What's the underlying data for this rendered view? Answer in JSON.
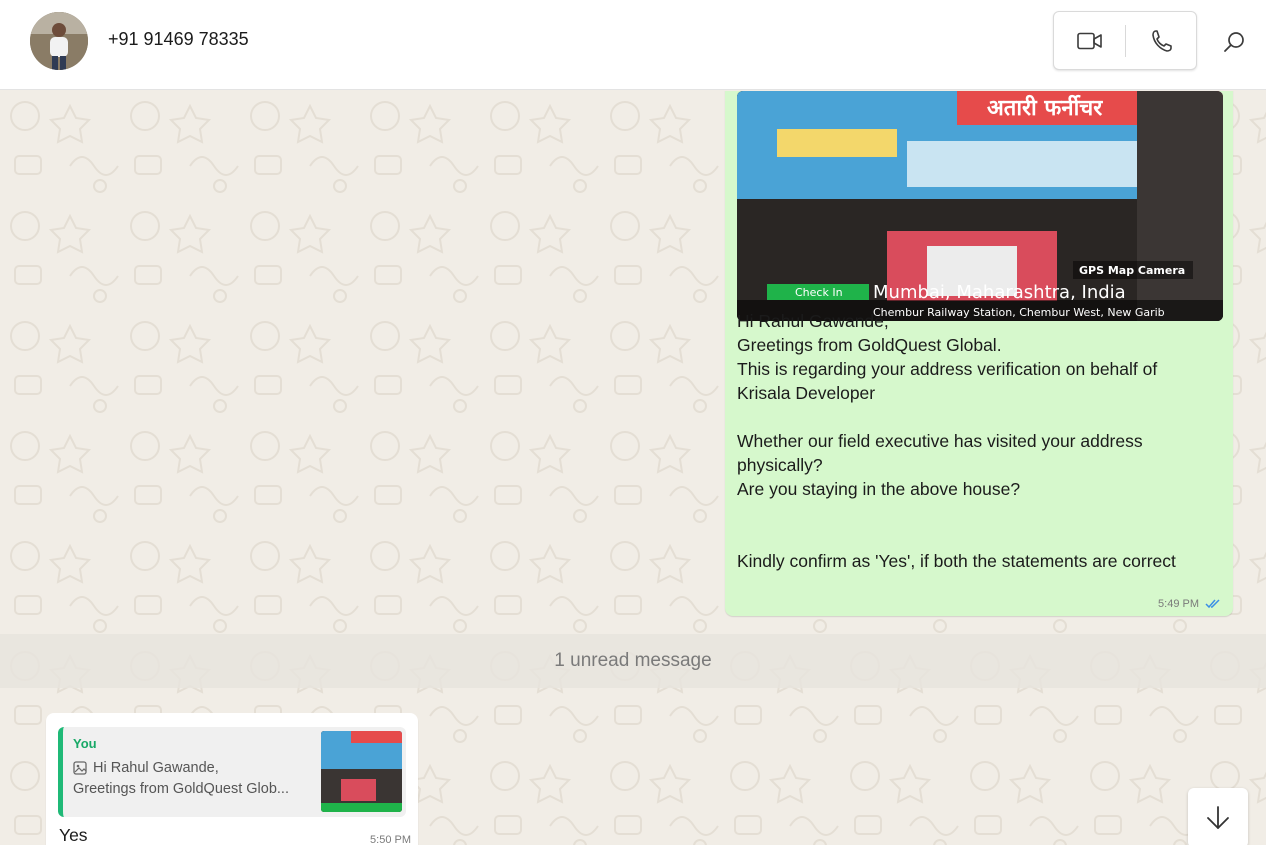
{
  "header": {
    "contact_name": "+91 91469 78335",
    "video_call_icon": "video-camera-icon",
    "voice_call_icon": "phone-icon",
    "search_icon": "search-icon"
  },
  "messages": {
    "outgoing": {
      "photo_overlay": {
        "shop_sign": "अतारी फर्नीचर",
        "app_badge": "GPS Map Camera",
        "check_in": "Check In",
        "location": "Mumbai, Maharashtra, India",
        "address": "Chembur Railway Station, Chembur West, New Garib"
      },
      "text": "Hi Rahul Gawande,\nGreetings from GoldQuest Global.\nThis is regarding your address verification on behalf of Krisala Developer\n\nWhether our field executive has visited your address physically?\nAre you staying in the above house?\n\n\nKindly confirm as 'Yes', if both the statements are correct",
      "time": "5:49 PM",
      "status_icon": "double-check-read-icon"
    },
    "unread_divider": "1 unread message",
    "incoming": {
      "quote_author": "You",
      "quote_line1": "Hi Rahul Gawande,",
      "quote_line2": "Greetings from GoldQuest Glob...",
      "quote_icon": "image-icon",
      "text": "Yes",
      "time": "5:50 PM"
    }
  },
  "scroll_down_icon": "arrow-down-icon",
  "colors": {
    "outgoing_bubble": "#d6f8cc",
    "incoming_bubble": "#ffffff",
    "quote_accent": "#1fb977",
    "read_receipt": "#3b8fe6",
    "chat_background": "#f1ede6"
  }
}
